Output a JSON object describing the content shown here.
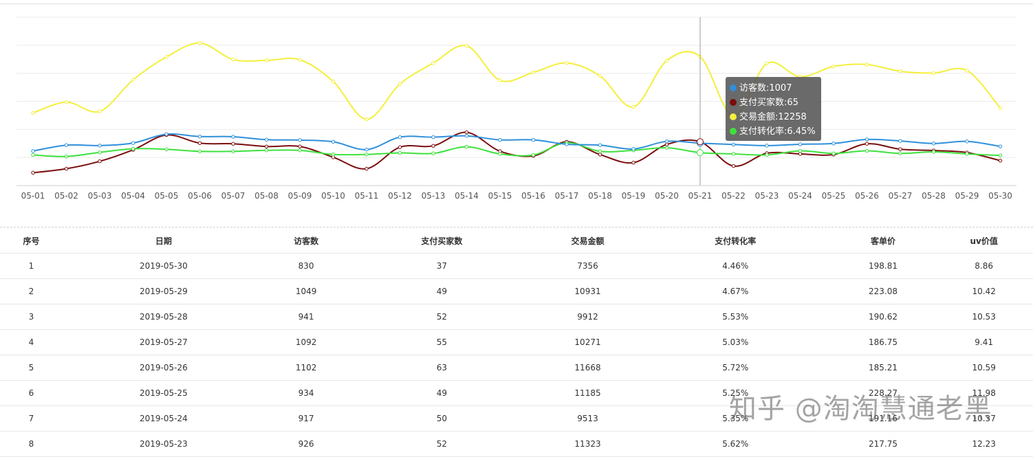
{
  "chart_data": {
    "type": "line",
    "categories": [
      "05-01",
      "05-02",
      "05-03",
      "05-04",
      "05-05",
      "05-06",
      "05-07",
      "05-08",
      "05-09",
      "05-10",
      "05-11",
      "05-12",
      "05-13",
      "05-14",
      "05-15",
      "05-16",
      "05-17",
      "05-18",
      "05-19",
      "05-20",
      "05-21",
      "05-22",
      "05-23",
      "05-24",
      "05-25",
      "05-26",
      "05-27",
      "05-28",
      "05-29",
      "05-30"
    ],
    "series": [
      {
        "name": "访客数",
        "color": "#2e8fdb",
        "unit": "",
        "values": [
          820,
          960,
          950,
          1010,
          1220,
          1165,
          1160,
          1090,
          1080,
          1040,
          855,
          1150,
          1150,
          1180,
          1085,
          1085,
          980,
          960,
          870,
          1050,
          1007,
          975,
          950,
          980,
          1000,
          1095,
          1060,
          1000,
          1049,
          930
        ]
      },
      {
        "name": "支付买家数",
        "color": "#7b0d0d",
        "unit": "",
        "values": [
          19,
          25,
          36,
          53,
          75,
          63,
          62,
          58,
          58,
          42,
          25,
          57,
          59,
          79,
          51,
          44,
          65,
          46,
          34,
          61,
          65,
          29,
          48,
          47,
          46,
          62,
          54,
          52,
          49,
          37
        ]
      },
      {
        "name": "交易金额",
        "color": "#f4ef3a",
        "unit": "",
        "values": [
          6900,
          7930,
          7050,
          10050,
          12220,
          13540,
          11980,
          11890,
          11960,
          9890,
          6300,
          9650,
          11640,
          13280,
          10000,
          10750,
          11650,
          10410,
          7480,
          11870,
          12258,
          6600,
          11600,
          10340,
          11320,
          11500,
          10860,
          10690,
          10931,
          7356
        ]
      },
      {
        "name": "支付转化率",
        "color": "#3de13d",
        "unit": "%",
        "values": [
          6.0,
          5.7,
          6.5,
          7.2,
          7.1,
          6.7,
          6.7,
          6.9,
          6.9,
          6.1,
          6.1,
          6.4,
          6.3,
          7.6,
          6.2,
          6.0,
          8.4,
          6.7,
          6.9,
          7.4,
          6.45,
          6.2,
          6.0,
          6.8,
          6.3,
          6.8,
          6.3,
          6.6,
          6.2,
          5.9
        ]
      }
    ],
    "grid": true,
    "legend": "none",
    "tooltip": {
      "index": 20,
      "rows": [
        {
          "color": "#2e8fdb",
          "text": "访客数:1007"
        },
        {
          "color": "#7b0d0d",
          "text": "支付买家数:65"
        },
        {
          "color": "#f4ef3a",
          "text": "交易金额:12258"
        },
        {
          "color": "#3de13d",
          "text": "支付转化率:6.45%"
        }
      ]
    }
  },
  "table": {
    "headers": [
      "序号",
      "日期",
      "访客数",
      "支付买家数",
      "交易金额",
      "支付转化率",
      "客单价",
      "uv价值"
    ],
    "rows": [
      [
        "1",
        "2019-05-30",
        "830",
        "37",
        "7356",
        "4.46%",
        "198.81",
        "8.86"
      ],
      [
        "2",
        "2019-05-29",
        "1049",
        "49",
        "10931",
        "4.67%",
        "223.08",
        "10.42"
      ],
      [
        "3",
        "2019-05-28",
        "941",
        "52",
        "9912",
        "5.53%",
        "190.62",
        "10.53"
      ],
      [
        "4",
        "2019-05-27",
        "1092",
        "55",
        "10271",
        "5.03%",
        "186.75",
        "9.41"
      ],
      [
        "5",
        "2019-05-26",
        "1102",
        "63",
        "11668",
        "5.72%",
        "185.21",
        "10.59"
      ],
      [
        "6",
        "2019-05-25",
        "934",
        "49",
        "11185",
        "5.25%",
        "228.27",
        "11.98"
      ],
      [
        "7",
        "2019-05-24",
        "917",
        "50",
        "9513",
        "5.35%",
        "191.16",
        "10.37"
      ],
      [
        "8",
        "2019-05-23",
        "926",
        "52",
        "11323",
        "5.62%",
        "217.75",
        "12.23"
      ]
    ]
  },
  "watermark": "知乎 @淘淘慧通老黑"
}
